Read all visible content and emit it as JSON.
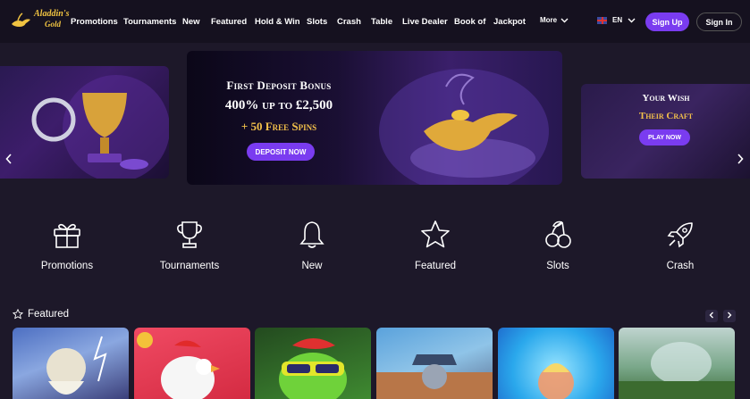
{
  "brand": {
    "logo_line1": "Aladdin's",
    "logo_line2": "Gold"
  },
  "nav": {
    "items": [
      "Promotions",
      "Tournaments",
      "New",
      "Featured",
      "Hold & Win",
      "Slots",
      "Crash",
      "Table",
      "Live Dealer",
      "Book of",
      "Jackpot"
    ],
    "more_label": "More",
    "language": "EN",
    "signup_label": "Sign Up",
    "signin_label": "Sign In"
  },
  "banner": {
    "main": {
      "title": "First Deposit Bonus",
      "amount": "400% up to £2,500",
      "spins": "+ 50 Free Spins",
      "cta": "DEPOSIT NOW"
    },
    "right": {
      "line1": "Your Wish",
      "line2": "Their Craft",
      "cta": "PLAY NOW"
    }
  },
  "categories": [
    {
      "label": "Promotions",
      "icon": "gift-icon"
    },
    {
      "label": "Tournaments",
      "icon": "trophy-icon"
    },
    {
      "label": "New",
      "icon": "bell-icon"
    },
    {
      "label": "Featured",
      "icon": "star-icon"
    },
    {
      "label": "Slots",
      "icon": "cherries-icon"
    },
    {
      "label": "Crash",
      "icon": "rocket-icon"
    }
  ],
  "featured": {
    "title": "Featured",
    "colors": [
      "#6a8fd6",
      "#e8394e",
      "#2f7a2a",
      "#5d9bd0",
      "#2fa6e8",
      "#7aa88a"
    ]
  },
  "colors": {
    "accent": "#7a3cf0",
    "gold": "#f2c04a",
    "background": "#1d1829",
    "nav_bg": "#15111f"
  }
}
